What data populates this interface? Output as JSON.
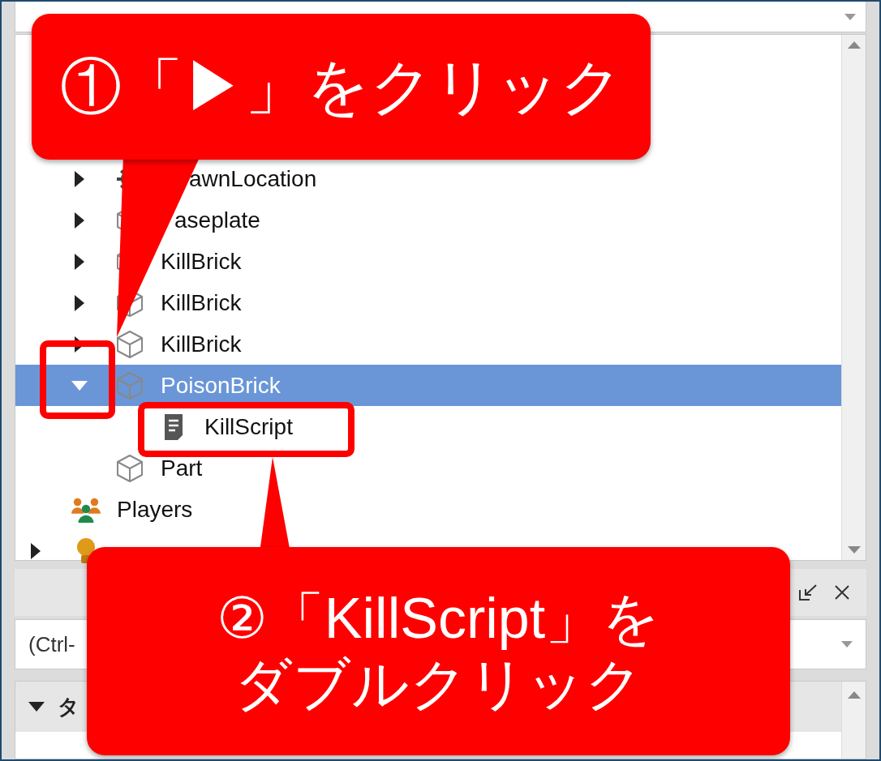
{
  "explorer": {
    "tree": [
      {
        "children": [
          {
            "label": "awnLocation",
            "kind": "spawn",
            "expanded": false,
            "selected": false
          },
          {
            "label": "aseplate",
            "kind": "part",
            "expanded": false,
            "selected": false
          },
          {
            "label": "KillBrick",
            "kind": "part",
            "expanded": false,
            "selected": false
          },
          {
            "label": "KillBrick",
            "kind": "part",
            "expanded": false,
            "selected": false
          },
          {
            "label": "KillBrick",
            "kind": "part",
            "expanded": false,
            "selected": false
          },
          {
            "label": "PoisonBrick",
            "kind": "part",
            "expanded": true,
            "selected": true,
            "children": [
              {
                "label": "KillScript",
                "kind": "script",
                "selected": false
              }
            ]
          },
          {
            "label": "Part",
            "kind": "part",
            "selected": false
          }
        ]
      },
      {
        "label": "Players",
        "kind": "players",
        "selected": false
      },
      {
        "kind": "lighting",
        "expanded": false,
        "selected": false
      }
    ]
  },
  "properties": {
    "filter": {
      "placeholder": "(Ctrl-"
    },
    "section": {
      "label": "タ",
      "expanded": true
    }
  },
  "callouts": [
    {
      "lines": [
        "①「▶」をクリック"
      ]
    },
    {
      "lines": [
        "②「KillScript」を",
        "ダブルクリック"
      ]
    }
  ]
}
